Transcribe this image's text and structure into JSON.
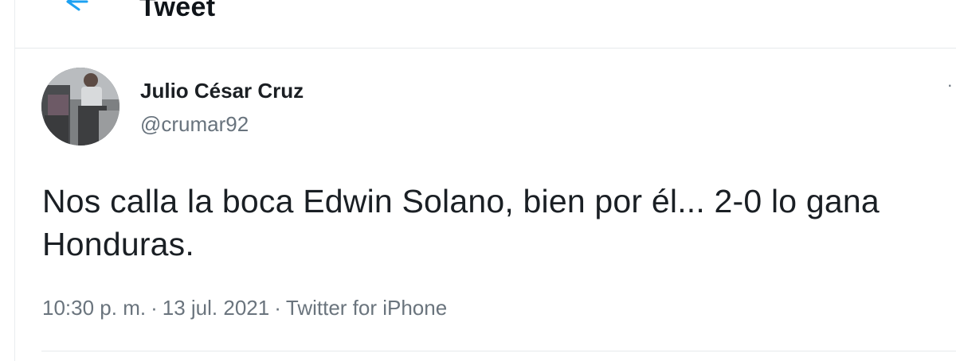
{
  "header": {
    "back_icon": "arrow-left-icon",
    "title": "Tweet"
  },
  "tweet": {
    "author": {
      "display_name": "Julio César Cruz",
      "handle": "@crumar92"
    },
    "more_icon": "more-dots-icon",
    "text": "Nos calla la boca Edwin Solano, bien por él... 2-0 lo gana Honduras.",
    "meta": {
      "time": "10:30 p. m.",
      "separator": "·",
      "date": "13 jul. 2021",
      "source": "Twitter for iPhone"
    }
  },
  "colors": {
    "accent": "#1da1f2",
    "text_primary": "#0f1419",
    "text_secondary": "#68737d",
    "divider": "#e6eaec"
  }
}
